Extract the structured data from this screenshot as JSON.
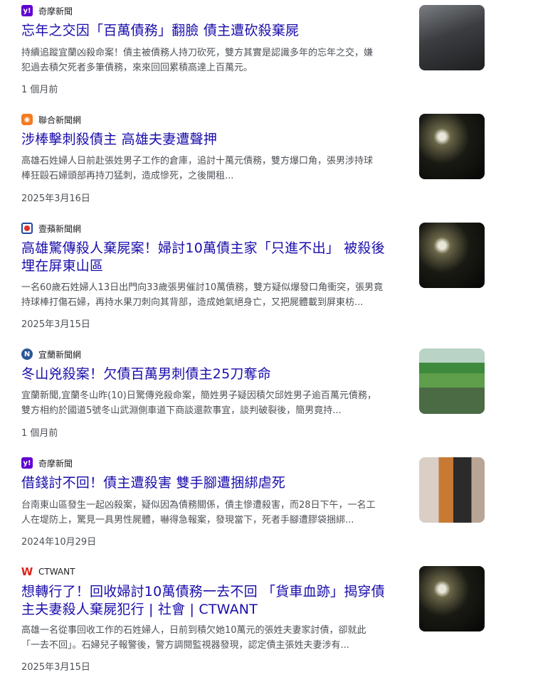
{
  "results": [
    {
      "source": "奇摩新聞",
      "source_icon": "yahoo-logo-icon",
      "title": "忘年之交因「百萬債務」翻臉 債主遭砍殺棄屍",
      "snippet_lines": [
        "持續追蹤宜蘭凶殺命案！債主被債務人持刀砍死，雙方其實是認識多年的忘年之交，嫌",
        "犯過去積欠死者多筆債務，來來回回累積高達上百萬元。"
      ],
      "date": "1 個月前",
      "thumbnail": "dark-car-interior-photo"
    },
    {
      "source": "聯合新聞網",
      "source_icon": "udn-logo-icon",
      "title": "涉棒擊刺殺債主 高雄夫妻遭聲押",
      "snippet_lines": [
        "高雄石姓婦人日前赴張姓男子工作的倉庫，追討十萬元債務，雙方爆口角，張男涉持球",
        "棒狂毆石婦頭部再持刀猛刺，造成慘死，之後開租..."
      ],
      "date": "2025年3月16日",
      "thumbnail": "night-crime-scene-photo"
    },
    {
      "source": "壹蘋新聞網",
      "source_icon": "nextapple-logo-icon",
      "title_lines": [
        "高雄驚傳殺人棄屍案！婦討10萬債主家「只進不出」 被殺後",
        "埋在屏東山區"
      ],
      "snippet_lines": [
        "一名60歲石姓婦人13日出門向33歲張男催討10萬債務，雙方疑似爆發口角衝突，張男竟",
        "持球棒打傷石婦，再持水果刀刺向其背部，造成她氣絕身亡，又把屍體載到屏東枋..."
      ],
      "date": "2025年3月15日",
      "thumbnail": "night-crime-scene-photo"
    },
    {
      "source": "宜蘭新聞網",
      "source_icon": "yilan-logo-icon",
      "title": "冬山兇殺案！欠債百萬男刺債主25刀奪命",
      "snippet_lines": [
        "宜蘭新聞,宜蘭冬山昨(10)日驚傳兇殺命案，簡姓男子疑因積欠邱姓男子逾百萬元債務，",
        "雙方相約於國道5號冬山武淵側車道下商談還款事宜，談判破裂後，簡男竟持..."
      ],
      "date": "1 個月前",
      "thumbnail": "roadside-grass-scene-photo"
    },
    {
      "source": "奇摩新聞",
      "source_icon": "yahoo-logo-icon",
      "title": "借錢討不回！債主遭殺害 雙手腳遭捆綁虐死",
      "snippet_lines": [
        "台南東山區發生一起凶殺案，疑似因為債務關係，債主慘遭殺害，而28日下午，一名工",
        "人在堤防上，驚見一具男性屍體，嚇得急報案，發現當下，死者手腳遭膠袋捆綁..."
      ],
      "date": "2024年10月29日",
      "thumbnail": "police-escort-photo"
    },
    {
      "source": "CTWANT",
      "source_icon": "ctwant-logo-icon",
      "title_lines": [
        "想轉行了！回收婦討10萬債務一去不回 「貨車血跡」揭穿債",
        "主夫妻殺人棄屍犯行 | 社會 | CTWANT"
      ],
      "snippet_lines": [
        "高雄一名從事回收工作的石姓婦人，日前到積欠她10萬元的張姓夫妻家討債，卻就此",
        "「一去不回」。石婦兒子報警後，警方調閱監視器發現，認定債主張姓夫妻涉有..."
      ],
      "date": "2025年3月15日",
      "thumbnail": "night-crime-scene-photo"
    }
  ]
}
